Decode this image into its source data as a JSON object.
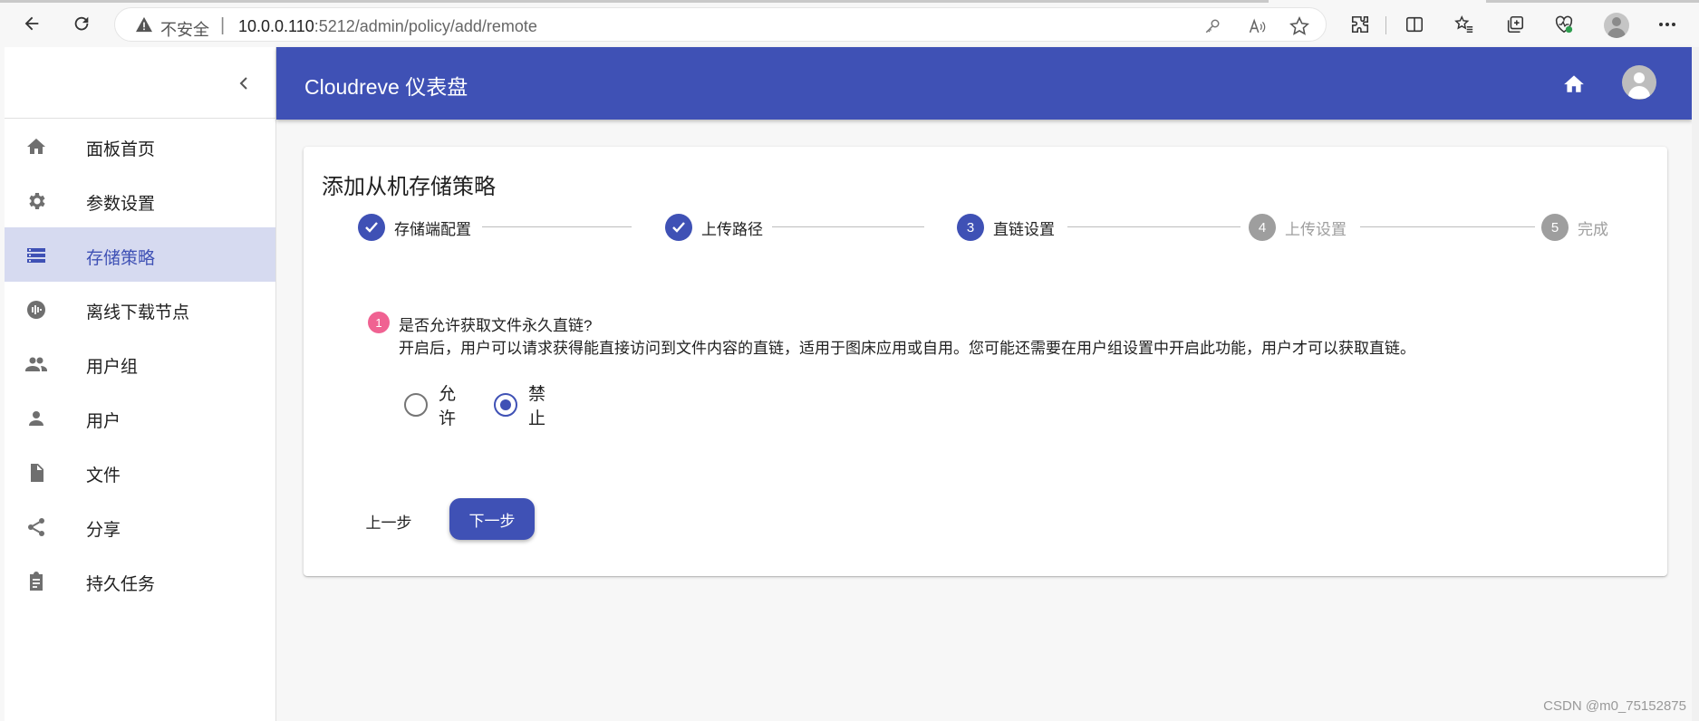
{
  "browser": {
    "insecure_label": "不安全",
    "url_host": "10.0.0.110",
    "url_rest": ":5212/admin/policy/add/remote"
  },
  "header": {
    "title": "Cloudreve 仪表盘"
  },
  "sidebar": {
    "items": [
      {
        "label": "面板首页",
        "icon": "home-icon"
      },
      {
        "label": "参数设置",
        "icon": "gear-icon"
      },
      {
        "label": "存储策略",
        "icon": "storage-icon",
        "active": true
      },
      {
        "label": "离线下载节点",
        "icon": "download-node-icon"
      },
      {
        "label": "用户组",
        "icon": "group-icon"
      },
      {
        "label": "用户",
        "icon": "person-icon"
      },
      {
        "label": "文件",
        "icon": "file-icon"
      },
      {
        "label": "分享",
        "icon": "share-icon"
      },
      {
        "label": "持久任务",
        "icon": "task-icon"
      }
    ]
  },
  "page": {
    "title": "添加从机存储策略",
    "steps": [
      {
        "label": "存储端配置",
        "state": "done",
        "number": "1"
      },
      {
        "label": "上传路径",
        "state": "done",
        "number": "2"
      },
      {
        "label": "直链设置",
        "state": "active",
        "number": "3"
      },
      {
        "label": "上传设置",
        "state": "pending",
        "number": "4"
      },
      {
        "label": "完成",
        "state": "pending",
        "number": "5"
      }
    ],
    "question": {
      "badge": "1",
      "title": "是否允许获取文件永久直链?",
      "description": "开启后，用户可以请求获得能直接访问到文件内容的直链，适用于图床应用或自用。您可能还需要在用户组设置中开启此功能，用户才可以获取直链。"
    },
    "options": [
      {
        "label": "允许",
        "checked": false
      },
      {
        "label": "禁止",
        "checked": true
      }
    ],
    "prev_label": "上一步",
    "next_label": "下一步"
  },
  "watermark": "CSDN @m0_75152875",
  "colors": {
    "primary": "#3f51b5",
    "active_bg": "#d6daf0",
    "badge": "#f06292"
  }
}
